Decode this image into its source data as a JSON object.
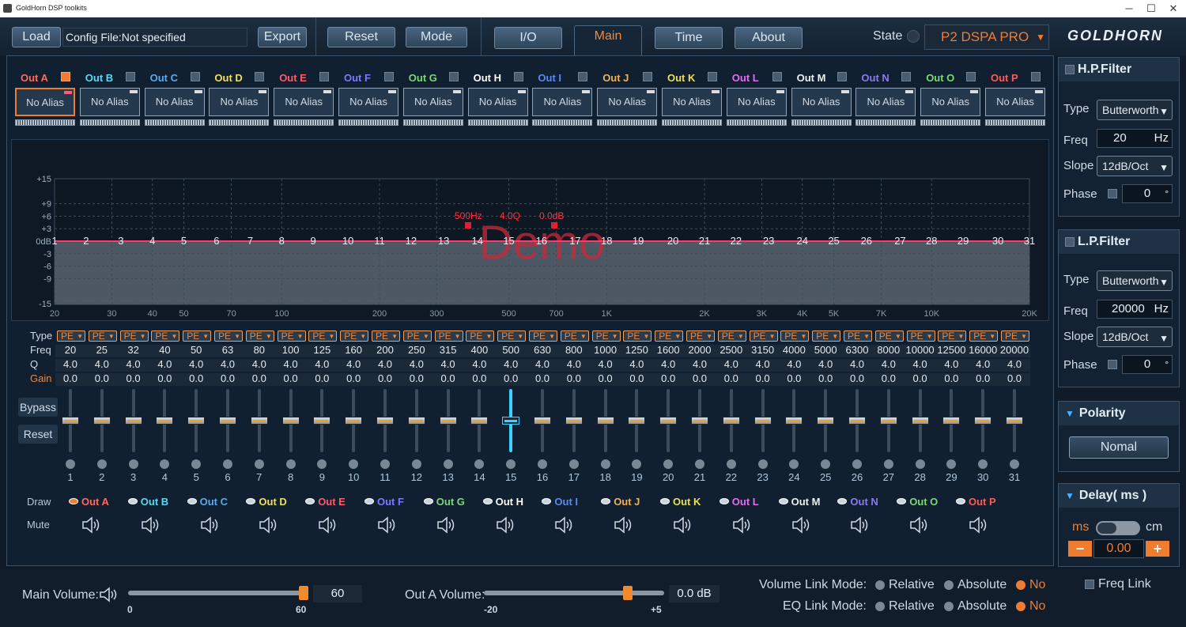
{
  "window": {
    "title": "GoldHorn DSP toolkits"
  },
  "toolbar": {
    "load": "Load",
    "config_file": "Config File:Not specified",
    "export": "Export",
    "reset": "Reset",
    "mode": "Mode"
  },
  "tabs": [
    {
      "label": "I/O"
    },
    {
      "label": "Main"
    },
    {
      "label": "Time"
    },
    {
      "label": "About"
    }
  ],
  "state": {
    "label": "State",
    "device": "P2 DSPA PRO",
    "logo": "GOLDHORN"
  },
  "channels": [
    {
      "label": "Out  A",
      "alias": "No Alias",
      "color": "#ff6a5a",
      "checked": true
    },
    {
      "label": "Out  B",
      "alias": "No Alias",
      "color": "#5ad8f0",
      "checked": false
    },
    {
      "label": "Out  C",
      "alias": "No Alias",
      "color": "#5aa8f0",
      "checked": false
    },
    {
      "label": "Out  D",
      "alias": "No Alias",
      "color": "#f0e05a",
      "checked": false
    },
    {
      "label": "Out  E",
      "alias": "No Alias",
      "color": "#ff5a6a",
      "checked": false
    },
    {
      "label": "Out  F",
      "alias": "No Alias",
      "color": "#7a7aff",
      "checked": false
    },
    {
      "label": "Out  G",
      "alias": "No Alias",
      "color": "#7ad87a",
      "checked": false
    },
    {
      "label": "Out  H",
      "alias": "No Alias",
      "color": "#ffffff",
      "checked": false
    },
    {
      "label": "Out  I",
      "alias": "No Alias",
      "color": "#5a8af0",
      "checked": false
    },
    {
      "label": "Out  J",
      "alias": "No Alias",
      "color": "#f0b05a",
      "checked": false
    },
    {
      "label": "Out  K",
      "alias": "No Alias",
      "color": "#e8e05a",
      "checked": false
    },
    {
      "label": "Out  L",
      "alias": "No Alias",
      "color": "#e86af0",
      "checked": false
    },
    {
      "label": "Out  M",
      "alias": "No Alias",
      "color": "#e8f0f0",
      "checked": false
    },
    {
      "label": "Out  N",
      "alias": "No Alias",
      "color": "#8a7af0",
      "checked": false
    },
    {
      "label": "Out  O",
      "alias": "No Alias",
      "color": "#7ad87a",
      "checked": false
    },
    {
      "label": "Out  P",
      "alias": "No Alias",
      "color": "#ff5a5a",
      "checked": false
    }
  ],
  "graph": {
    "db_labels": [
      "+15",
      "+9",
      "+6",
      "+3",
      "0dB",
      "-3",
      "-6",
      "-9",
      "-15"
    ],
    "freq_labels": [
      "20",
      "30",
      "40",
      "50",
      "70",
      "100",
      "200",
      "300",
      "500",
      "700",
      "1K",
      "2K",
      "3K",
      "4K",
      "5K",
      "7K",
      "10K",
      "20K"
    ],
    "marker": {
      "freq": "500Hz",
      "q": "4.0Q",
      "gain": "0.0dB"
    },
    "watermark": "Demo"
  },
  "eq_rows": {
    "type": "Type",
    "freq": "Freq",
    "q": "Q",
    "gain": "Gain"
  },
  "eq_type": "PE",
  "bands": [
    {
      "n": "1",
      "freq": "20",
      "q": "4.0",
      "gain": "0.0"
    },
    {
      "n": "2",
      "freq": "25",
      "q": "4.0",
      "gain": "0.0"
    },
    {
      "n": "3",
      "freq": "32",
      "q": "4.0",
      "gain": "0.0"
    },
    {
      "n": "4",
      "freq": "40",
      "q": "4.0",
      "gain": "0.0"
    },
    {
      "n": "5",
      "freq": "50",
      "q": "4.0",
      "gain": "0.0"
    },
    {
      "n": "6",
      "freq": "63",
      "q": "4.0",
      "gain": "0.0"
    },
    {
      "n": "7",
      "freq": "80",
      "q": "4.0",
      "gain": "0.0"
    },
    {
      "n": "8",
      "freq": "100",
      "q": "4.0",
      "gain": "0.0"
    },
    {
      "n": "9",
      "freq": "125",
      "q": "4.0",
      "gain": "0.0"
    },
    {
      "n": "10",
      "freq": "160",
      "q": "4.0",
      "gain": "0.0"
    },
    {
      "n": "11",
      "freq": "200",
      "q": "4.0",
      "gain": "0.0"
    },
    {
      "n": "12",
      "freq": "250",
      "q": "4.0",
      "gain": "0.0"
    },
    {
      "n": "13",
      "freq": "315",
      "q": "4.0",
      "gain": "0.0"
    },
    {
      "n": "14",
      "freq": "400",
      "q": "4.0",
      "gain": "0.0"
    },
    {
      "n": "15",
      "freq": "500",
      "q": "4.0",
      "gain": "0.0"
    },
    {
      "n": "16",
      "freq": "630",
      "q": "4.0",
      "gain": "0.0"
    },
    {
      "n": "17",
      "freq": "800",
      "q": "4.0",
      "gain": "0.0"
    },
    {
      "n": "18",
      "freq": "1000",
      "q": "4.0",
      "gain": "0.0"
    },
    {
      "n": "19",
      "freq": "1250",
      "q": "4.0",
      "gain": "0.0"
    },
    {
      "n": "20",
      "freq": "1600",
      "q": "4.0",
      "gain": "0.0"
    },
    {
      "n": "21",
      "freq": "2000",
      "q": "4.0",
      "gain": "0.0"
    },
    {
      "n": "22",
      "freq": "2500",
      "q": "4.0",
      "gain": "0.0"
    },
    {
      "n": "23",
      "freq": "3150",
      "q": "4.0",
      "gain": "0.0"
    },
    {
      "n": "24",
      "freq": "4000",
      "q": "4.0",
      "gain": "0.0"
    },
    {
      "n": "25",
      "freq": "5000",
      "q": "4.0",
      "gain": "0.0"
    },
    {
      "n": "26",
      "freq": "6300",
      "q": "4.0",
      "gain": "0.0"
    },
    {
      "n": "27",
      "freq": "8000",
      "q": "4.0",
      "gain": "0.0"
    },
    {
      "n": "28",
      "freq": "10000",
      "q": "4.0",
      "gain": "0.0"
    },
    {
      "n": "29",
      "freq": "12500",
      "q": "4.0",
      "gain": "0.0"
    },
    {
      "n": "30",
      "freq": "16000",
      "q": "4.0",
      "gain": "0.0"
    },
    {
      "n": "31",
      "freq": "20000",
      "q": "4.0",
      "gain": "0.0"
    }
  ],
  "selected_band": "15",
  "eq_buttons": {
    "bypass": "Bypass",
    "reset": "Reset"
  },
  "draw": {
    "label": "Draw",
    "mute_label": "Mute"
  },
  "hpf": {
    "title": "H.P.Filter",
    "type_label": "Type",
    "type": "Butterworth",
    "freq_label": "Freq",
    "freq": "20",
    "freq_unit": "Hz",
    "slope_label": "Slope",
    "slope": "12dB/Oct",
    "phase_label": "Phase",
    "phase": "0",
    "phase_unit": "°"
  },
  "lpf": {
    "title": "L.P.Filter",
    "type_label": "Type",
    "type": "Butterworth",
    "freq_label": "Freq",
    "freq": "20000",
    "freq_unit": "Hz",
    "slope_label": "Slope",
    "slope": "12dB/Oct",
    "phase_label": "Phase",
    "phase": "0",
    "phase_unit": "°"
  },
  "polarity": {
    "title": "Polarity",
    "value": "Nomal"
  },
  "delay": {
    "title": "Delay( ms )",
    "unit_ms": "ms",
    "unit_cm": "cm",
    "minus": "−",
    "value": "0.00",
    "plus": "+"
  },
  "bottom": {
    "main_volume_label": "Main Volume:",
    "main_volume": "60",
    "main_min": "0",
    "main_max": "60",
    "main_level": 1.0,
    "out_volume_label": "Out A Volume:",
    "out_volume": "0.0  dB",
    "out_min": "-20",
    "out_max": "+5",
    "out_level": 0.8,
    "vol_link_label": "Volume Link Mode:",
    "eq_link_label": "EQ Link Mode:",
    "relative": "Relative",
    "absolute": "Absolute",
    "no": "No",
    "freq_link": "Freq Link"
  },
  "colors": {
    "accent": "#f07c32",
    "curve": "#ff3a6a",
    "selected_slider": "#3ad0ff"
  }
}
